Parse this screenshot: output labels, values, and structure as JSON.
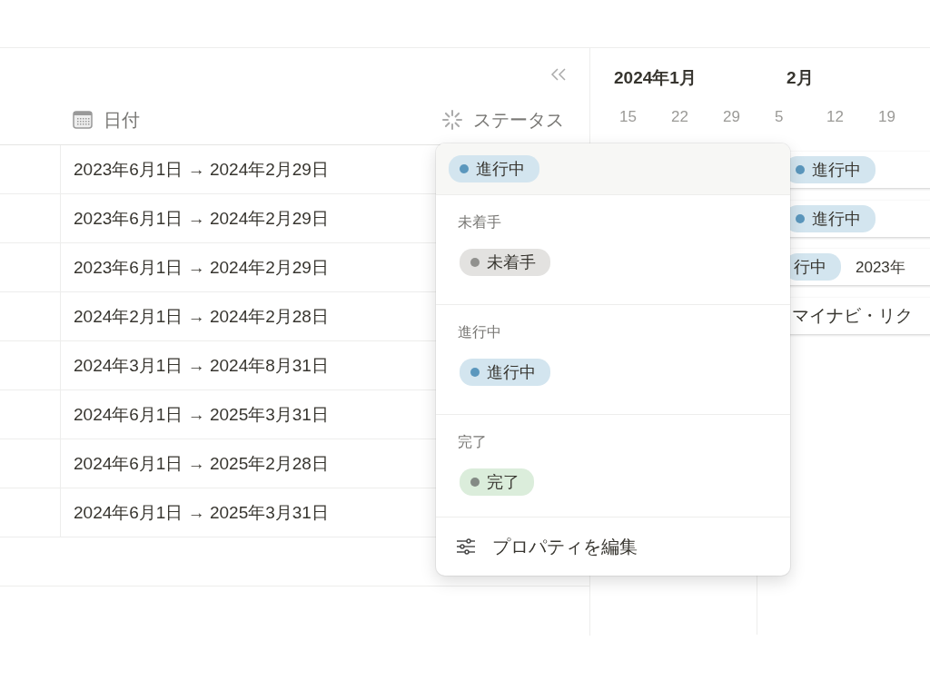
{
  "table": {
    "columns": [
      {
        "kind": "blank"
      },
      {
        "kind": "date",
        "label": "日付"
      },
      {
        "kind": "status",
        "label": "ステータス"
      }
    ],
    "rows": [
      {
        "date": "2023年6月1日 → 2024年2月29日"
      },
      {
        "date": "2023年6月1日 → 2024年2月29日"
      },
      {
        "date": "2023年6月1日 → 2024年2月29日"
      },
      {
        "date": "2024年2月1日 → 2024年2月28日"
      },
      {
        "date": "2024年3月1日 → 2024年8月31日"
      },
      {
        "date": "2024年6月1日 → 2025年3月31日"
      },
      {
        "date": "2024年6月1日 → 2025年2月28日"
      },
      {
        "date": "2024年6月1日 → 2025年3月31日"
      }
    ]
  },
  "timeline": {
    "months": [
      "2024年1月",
      "2月"
    ],
    "weeks": [
      "15",
      "22",
      "29",
      "5",
      "12",
      "19"
    ],
    "bars": [
      {
        "status": "進行中",
        "kind": "in_progress"
      },
      {
        "status": "進行中",
        "kind": "in_progress"
      },
      {
        "status": "行中",
        "kind": "in_progress",
        "date": "2023年"
      },
      {
        "title": "マイナビ・リク"
      }
    ]
  },
  "status_menu": {
    "current": {
      "label": "進行中",
      "kind": "in_progress",
      "color": "#5b97bd"
    },
    "groups": [
      {
        "label": "未着手",
        "options": [
          {
            "label": "未着手",
            "kind": "not_started",
            "color": "#91918e"
          }
        ]
      },
      {
        "label": "進行中",
        "options": [
          {
            "label": "進行中",
            "kind": "in_progress",
            "color": "#5b97bd"
          }
        ]
      },
      {
        "label": "完了",
        "options": [
          {
            "label": "完了",
            "kind": "done",
            "color": "#848a85"
          }
        ]
      }
    ],
    "footer": "プロパティを編集"
  }
}
